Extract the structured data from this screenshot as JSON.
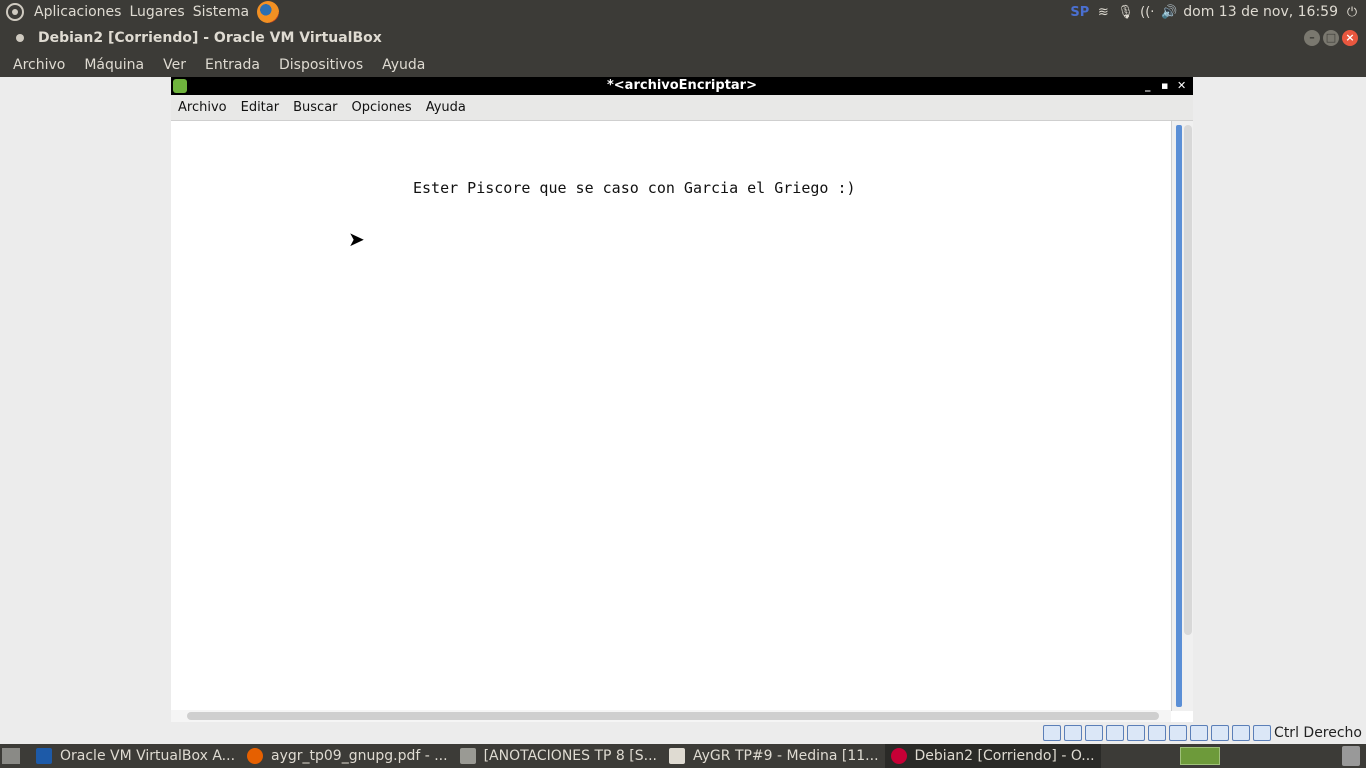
{
  "top_panel": {
    "menus": [
      "Aplicaciones",
      "Lugares",
      "Sistema"
    ],
    "indicator": "SP",
    "clock": "dom 13 de nov, 16:59"
  },
  "vbox": {
    "title": "Debian2 [Corriendo] - Oracle VM VirtualBox",
    "menu": [
      "Archivo",
      "Máquina",
      "Ver",
      "Entrada",
      "Dispositivos",
      "Ayuda"
    ],
    "host_key": "Ctrl Derecho"
  },
  "editor": {
    "title": "*<archivoEncriptar>",
    "menu": [
      "Archivo",
      "Editar",
      "Buscar",
      "Opciones",
      "Ayuda"
    ],
    "text": "Ester Piscore que se caso con Garcia el Griego :)"
  },
  "taskbar": {
    "tasks": [
      {
        "label": "Oracle VM VirtualBox A...",
        "icon": "virtualbox-icon"
      },
      {
        "label": "aygr_tp09_gnupg.pdf - ...",
        "icon": "firefox-icon"
      },
      {
        "label": "[ANOTACIONES TP 8 [S...",
        "icon": "text-editor-icon"
      },
      {
        "label": "AyGR TP#9 - Medina [11...",
        "icon": "document-icon"
      },
      {
        "label": "Debian2 [Corriendo] - O...",
        "icon": "debian-icon"
      }
    ]
  },
  "colors": {
    "panel": "#3c3b37",
    "close_button": "#e9573f",
    "scroll_lane": "#5b8fd6"
  }
}
